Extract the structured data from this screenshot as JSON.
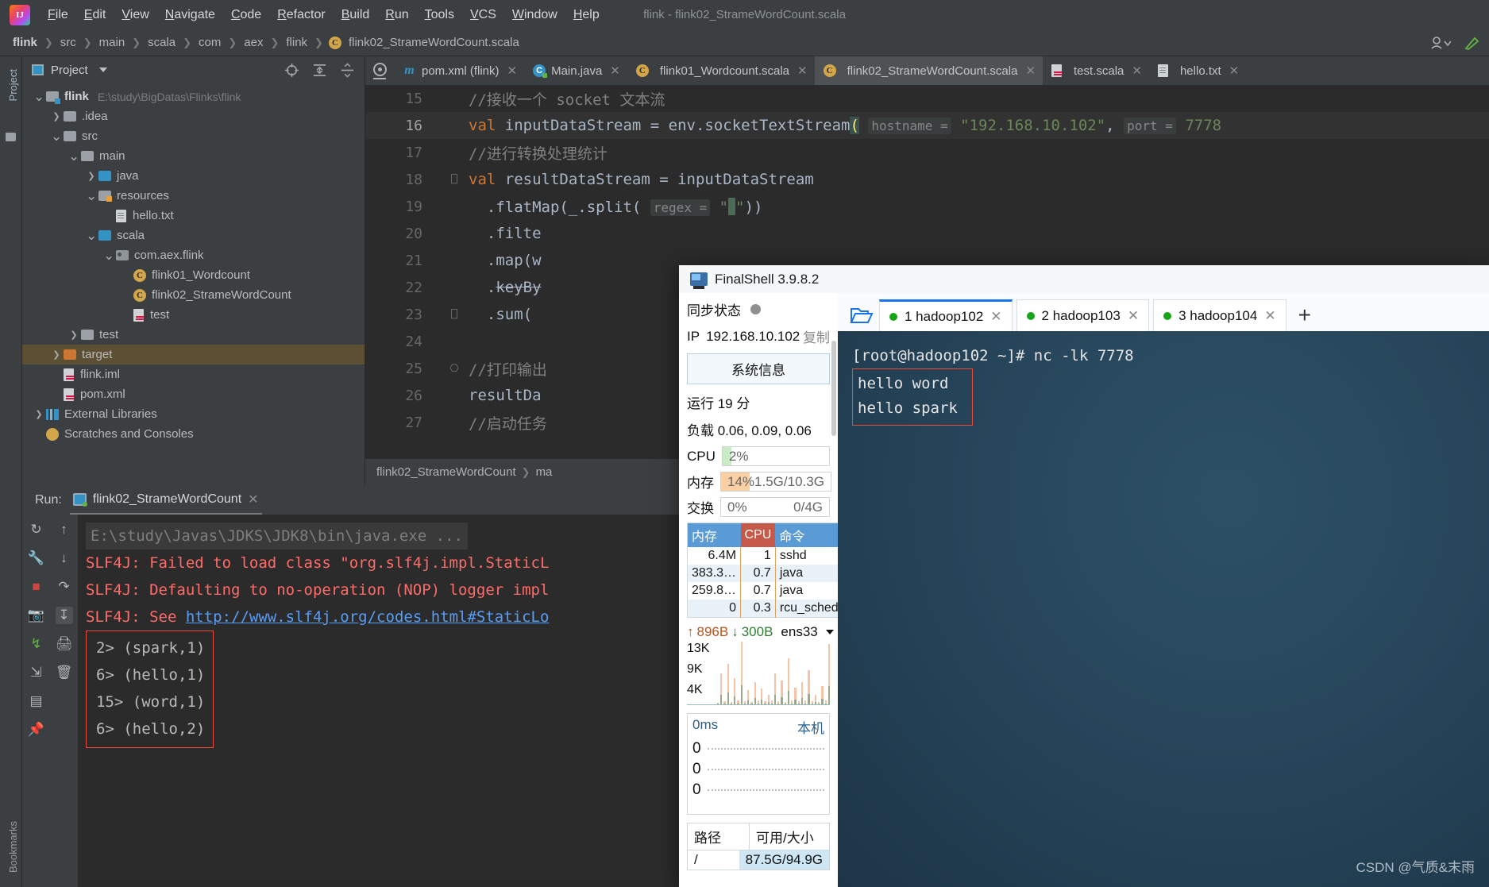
{
  "window": {
    "title": "flink - flink02_StrameWordCount.scala"
  },
  "menu": {
    "items": [
      "File",
      "Edit",
      "View",
      "Navigate",
      "Code",
      "Refactor",
      "Build",
      "Run",
      "Tools",
      "VCS",
      "Window",
      "Help"
    ]
  },
  "navbar": {
    "crumbs": [
      "flink",
      "src",
      "main",
      "scala",
      "com",
      "aex",
      "flink",
      "flink02_StrameWordCount.scala"
    ]
  },
  "left_strip": {
    "top_tab": "Project",
    "bottom_tab": "Bookmarks"
  },
  "project_panel": {
    "title": "Project",
    "tree": [
      {
        "indent": 0,
        "arrow": "v",
        "icon": "module",
        "label": "flink",
        "bold": true,
        "path": "E:\\study\\BigDatas\\Flinks\\flink"
      },
      {
        "indent": 1,
        "arrow": ">",
        "icon": "folder",
        "label": ".idea"
      },
      {
        "indent": 1,
        "arrow": "v",
        "icon": "folder",
        "label": "src"
      },
      {
        "indent": 2,
        "arrow": "v",
        "icon": "folder",
        "label": "main"
      },
      {
        "indent": 3,
        "arrow": ">",
        "icon": "source",
        "label": "java"
      },
      {
        "indent": 3,
        "arrow": "v",
        "icon": "resources",
        "label": "resources"
      },
      {
        "indent": 4,
        "arrow": "",
        "icon": "text",
        "label": "hello.txt"
      },
      {
        "indent": 3,
        "arrow": "v",
        "icon": "source",
        "label": "scala"
      },
      {
        "indent": 4,
        "arrow": "v",
        "icon": "package",
        "label": "com.aex.flink"
      },
      {
        "indent": 5,
        "arrow": "",
        "icon": "class",
        "label": "flink01_Wordcount"
      },
      {
        "indent": 5,
        "arrow": "",
        "icon": "class",
        "label": "flink02_StrameWordCount"
      },
      {
        "indent": 5,
        "arrow": "",
        "icon": "scalafile",
        "label": "test"
      },
      {
        "indent": 2,
        "arrow": ">",
        "icon": "folder",
        "label": "test"
      },
      {
        "indent": 1,
        "arrow": ">",
        "icon": "target",
        "label": "target",
        "selected": true
      },
      {
        "indent": 1,
        "arrow": "",
        "icon": "iml",
        "label": "flink.iml"
      },
      {
        "indent": 1,
        "arrow": "",
        "icon": "maven",
        "label": "pom.xml"
      },
      {
        "indent": 0,
        "arrow": ">",
        "icon": "libs",
        "label": "External Libraries"
      },
      {
        "indent": 0,
        "arrow": "",
        "icon": "scratch",
        "label": "Scratches and Consoles"
      }
    ]
  },
  "editor": {
    "tabs": [
      {
        "label": "pom.xml (flink)",
        "icon": "maven-icon",
        "active": false
      },
      {
        "label": "Main.java",
        "icon": "java-class-icon",
        "active": false
      },
      {
        "label": "flink01_Wordcount.scala",
        "icon": "scala-class-icon",
        "active": false
      },
      {
        "label": "flink02_StrameWordCount.scala",
        "icon": "scala-class-icon",
        "active": true
      },
      {
        "label": "test.scala",
        "icon": "scala-file-icon",
        "active": false
      },
      {
        "label": "hello.txt",
        "icon": "text-file-icon",
        "active": false
      }
    ],
    "lines": [
      {
        "no": "15",
        "fold": "",
        "current": false,
        "html": "<span class='cm'>//接收一个 socket 文本流</span>"
      },
      {
        "no": "16",
        "fold": "",
        "current": true,
        "html": "<span class='kw'>val</span> inputDataStream = env.socketTextStream<span class='paren-hl'>(</span> <span class='hint'>hostname =</span> <span class='str'>\"192.168.10.102\"</span>, <span class='hint'>port =</span> <span class='str'>7778</span>"
      },
      {
        "no": "17",
        "fold": "",
        "current": false,
        "html": "<span class='cm'>//进行转换处理统计</span>"
      },
      {
        "no": "18",
        "fold": "-",
        "current": false,
        "html": "<span class='kw'>val</span> resultDataStream = inputDataStream"
      },
      {
        "no": "19",
        "fold": "",
        "current": false,
        "html": "  .flatMap(_.split( <span class='hint'>regex =</span> <span class='str'>\"</span><span class='caretbar'></span><span class='str'>\"</span>))"
      },
      {
        "no": "20",
        "fold": "",
        "current": false,
        "html": "  .filte"
      },
      {
        "no": "21",
        "fold": "",
        "current": false,
        "html": "  .map(w"
      },
      {
        "no": "22",
        "fold": "",
        "current": false,
        "html": "  .<span class='strike'>keyBy</span>"
      },
      {
        "no": "23",
        "fold": "-",
        "current": false,
        "html": "  .sum("
      },
      {
        "no": "24",
        "fold": "",
        "current": false,
        "html": ""
      },
      {
        "no": "25",
        "fold": "^",
        "current": false,
        "html": "<span class='cm'>//打印输出</span>"
      },
      {
        "no": "26",
        "fold": "",
        "current": false,
        "html": "resultDa"
      },
      {
        "no": "27",
        "fold": "",
        "current": false,
        "html": "<span class='cm'>//启动任务</span>"
      }
    ],
    "breadcrumbs": [
      "flink02_StrameWordCount",
      "ma"
    ]
  },
  "run_panel": {
    "label": "Run:",
    "tab": "flink02_StrameWordCount",
    "console": [
      {
        "type": "path",
        "text": "E:\\study\\Javas\\JDKS\\JDK8\\bin\\java.exe ..."
      },
      {
        "type": "err",
        "text": "SLF4J: Failed to load class \"org.slf4j.impl.StaticL"
      },
      {
        "type": "err",
        "text": "SLF4J: Defaulting to no-operation (NOP) logger impl"
      },
      {
        "type": "err",
        "text": "SLF4J: See ",
        "link": "http://www.slf4j.org/codes.html#StaticLo"
      }
    ],
    "boxed_output": [
      "2> (spark,1)",
      "6> (hello,1)",
      "15> (word,1)",
      "6> (hello,2)"
    ]
  },
  "finalshell": {
    "title": "FinalShell 3.9.8.2",
    "sidebar": {
      "sync_label": "同步状态",
      "ip_label": "IP",
      "ip_value": "192.168.10.102",
      "copy_label": "复制",
      "sysinfo_button": "系统信息",
      "uptime": "运行 19 分",
      "load": "负载 0.06, 0.09, 0.06",
      "meters": [
        {
          "name": "CPU",
          "pct": "2%",
          "right": "",
          "fill": 8,
          "color": "#c9ecc7"
        },
        {
          "name": "内存",
          "pct": "14%",
          "right": "1.5G/10.3G",
          "fill": 26,
          "color": "#fbcfa4"
        },
        {
          "name": "交换",
          "pct": "0%",
          "right": "0/4G",
          "fill": 0,
          "color": "#fbcfa4"
        }
      ],
      "proc_headers": [
        "内存",
        "CPU",
        "命令"
      ],
      "proc_rows": [
        [
          "6.4M",
          "1",
          "sshd"
        ],
        [
          "383.3…",
          "0.7",
          "java"
        ],
        [
          "259.8…",
          "0.7",
          "java"
        ],
        [
          "0",
          "0.3",
          "rcu_sched"
        ]
      ],
      "net": {
        "up": "896B",
        "down": "300B",
        "iface": "ens33",
        "yticks": [
          "13K",
          "9K",
          "4K"
        ],
        "values": [
          2,
          48,
          5,
          62,
          4,
          40,
          6,
          96,
          5,
          22,
          4,
          34,
          6,
          24,
          5,
          14,
          6,
          48,
          5,
          36,
          4,
          70,
          6,
          26,
          5,
          34,
          6,
          52,
          5,
          14,
          4,
          28,
          6,
          92
        ]
      },
      "ping": {
        "latency": "0ms",
        "host": "本机",
        "rows": [
          "0",
          "0",
          "0"
        ]
      },
      "disk": {
        "headers": [
          "路径",
          "可用/大小"
        ],
        "rows": [
          [
            "/",
            "87.5G/94.9G"
          ]
        ]
      }
    },
    "terminal": {
      "tabs": [
        {
          "label": "1 hadoop102",
          "active": true
        },
        {
          "label": "2 hadoop103",
          "active": false
        },
        {
          "label": "3 hadoop104",
          "active": false
        }
      ],
      "add_label": "+",
      "prompt_line": "[root@hadoop102 ~]# nc -lk 7778",
      "boxed_lines": [
        "hello word",
        "hello spark"
      ]
    }
  },
  "watermark": "CSDN @气质&末雨"
}
